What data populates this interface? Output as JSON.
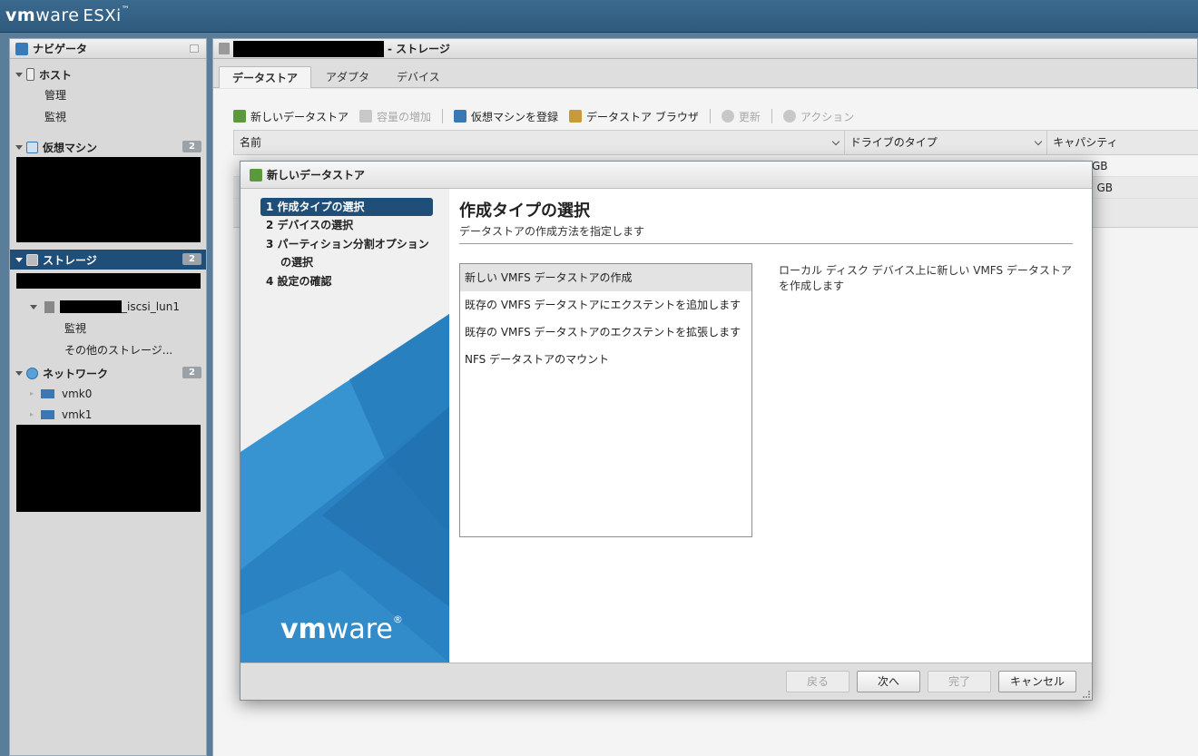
{
  "app": {
    "logo_vm": "vm",
    "logo_ware": "ware",
    "logo_esxi": "ESXi",
    "logo_tm": "™"
  },
  "navigator": {
    "title": "ナビゲータ",
    "host": {
      "label": "ホスト",
      "items": [
        "管理",
        "監視"
      ]
    },
    "vms": {
      "label": "仮想マシン",
      "count": "2"
    },
    "storage": {
      "label": "ストレージ",
      "count": "2",
      "datastore_suffix": "_iscsi_lun1",
      "items": [
        "監視",
        "その他のストレージ..."
      ]
    },
    "network": {
      "label": "ネットワーク",
      "count": "2",
      "items": [
        "vmk0",
        "vmk1"
      ]
    }
  },
  "main": {
    "title_suffix": "- ストレージ",
    "tabs": [
      "データストア",
      "アダプタ",
      "デバイス"
    ],
    "toolbar": {
      "new_datastore": "新しいデータストア",
      "increase_capacity": "容量の増加",
      "register_vm": "仮想マシンを登録",
      "browser": "データストア ブラウザ",
      "refresh": "更新",
      "actions": "アクション"
    },
    "columns": [
      "名前",
      "ドライブのタイプ",
      "キャパシティ"
    ],
    "rows": [
      {
        "capacity_tail": "GB"
      },
      {
        "capacity_tail": "5 GB"
      }
    ]
  },
  "dialog": {
    "title": "新しいデータストア",
    "steps": [
      "1 作成タイプの選択",
      "2 デバイスの選択",
      "3 パーティション分割オプション",
      "の選択",
      "4 設定の確認"
    ],
    "brand": {
      "vm": "vm",
      "ware": "ware",
      "reg": "®"
    },
    "pane_title": "作成タイプの選択",
    "pane_subtitle": "データストアの作成方法を指定します",
    "options": [
      "新しい VMFS データストアの作成",
      "既存の VMFS データストアにエクステントを追加します",
      "既存の VMFS データストアのエクステントを拡張します",
      "NFS データストアのマウント"
    ],
    "description": "ローカル ディスク デバイス上に新しい VMFS データストアを作成します",
    "buttons": {
      "back": "戻る",
      "next": "次へ",
      "finish": "完了",
      "cancel": "キャンセル"
    }
  }
}
